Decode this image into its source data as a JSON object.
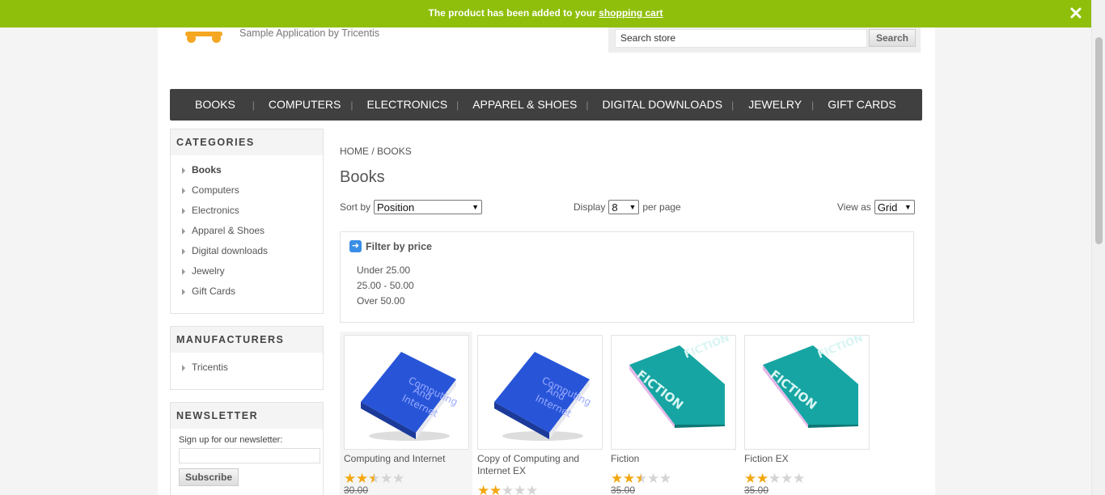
{
  "notice": {
    "text": "The product has been added to your ",
    "link": "shopping cart"
  },
  "header": {
    "tagline": "Sample Application by Tricentis",
    "search_value": "Search store",
    "search_button": "Search"
  },
  "menu": [
    "BOOKS",
    "COMPUTERS",
    "ELECTRONICS",
    "APPAREL & SHOES",
    "DIGITAL DOWNLOADS",
    "JEWELRY",
    "GIFT CARDS"
  ],
  "categories": {
    "title": "CATEGORIES",
    "items": [
      "Books",
      "Computers",
      "Electronics",
      "Apparel & Shoes",
      "Digital downloads",
      "Jewelry",
      "Gift Cards"
    ]
  },
  "manufacturers": {
    "title": "MANUFACTURERS",
    "items": [
      "Tricentis"
    ]
  },
  "newsletter": {
    "title": "NEWSLETTER",
    "label": "Sign up for our newsletter:",
    "button": "Subscribe"
  },
  "breadcrumb": {
    "home": "HOME",
    "sep": " / ",
    "current": "BOOKS"
  },
  "page_title": "Books",
  "sort": {
    "label": "Sort by",
    "value": "Position"
  },
  "display": {
    "label": "Display",
    "value": "8",
    "suffix": "per page"
  },
  "view": {
    "label": "View as",
    "value": "Grid"
  },
  "filter": {
    "title": "Filter by price",
    "ranges": [
      "Under 25.00",
      "25.00 - 50.00",
      "Over 50.00"
    ]
  },
  "products": [
    {
      "name": "Computing and Internet",
      "rating": 2.5,
      "price": "30.00",
      "image": "book-blue-icon"
    },
    {
      "name": "Copy of Computing and Internet EX",
      "rating": 2,
      "price": "",
      "image": "book-blue-icon"
    },
    {
      "name": "Fiction",
      "rating": 2.5,
      "price": "35.00",
      "image": "book-teal-icon"
    },
    {
      "name": "Fiction EX",
      "rating": 2,
      "price": "35.00",
      "image": "book-teal-icon"
    }
  ]
}
